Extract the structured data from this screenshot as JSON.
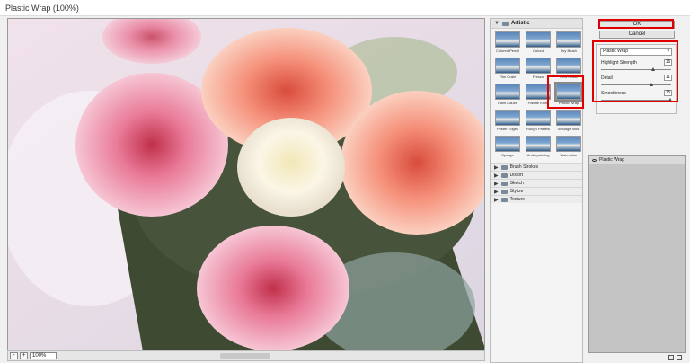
{
  "window": {
    "title": "Plastic Wrap (100%)"
  },
  "status": {
    "zoom_out": "-",
    "zoom_in": "+",
    "zoom": "100%"
  },
  "gallery": {
    "category": "Artistic",
    "filters": [
      "Colored Pencil",
      "Cutout",
      "Dry Brush",
      "Film Grain",
      "Fresco",
      "Neon Glow",
      "Paint Daubs",
      "Palette Knife",
      "Plastic Wrap",
      "Poster Edges",
      "Rough Pastels",
      "Smudge Stick",
      "Sponge",
      "Underpainting",
      "Watercolor"
    ],
    "selected": "Plastic Wrap",
    "other_categories": [
      "Brush Strokes",
      "Distort",
      "Sketch",
      "Stylize",
      "Texture"
    ]
  },
  "buttons": {
    "ok": "OK",
    "cancel": "Cancel"
  },
  "options": {
    "filter": "Plastic Wrap",
    "params": [
      {
        "label": "Highlight Strength",
        "value": "15",
        "fraction": 0.75
      },
      {
        "label": "Detail",
        "value": "11",
        "fraction": 0.73
      },
      {
        "label": "Smoothness",
        "value": "15",
        "fraction": 1.0
      }
    ]
  },
  "layers": {
    "items": [
      "Plastic Wrap"
    ]
  },
  "colors": {
    "highlight": "#e00000"
  }
}
